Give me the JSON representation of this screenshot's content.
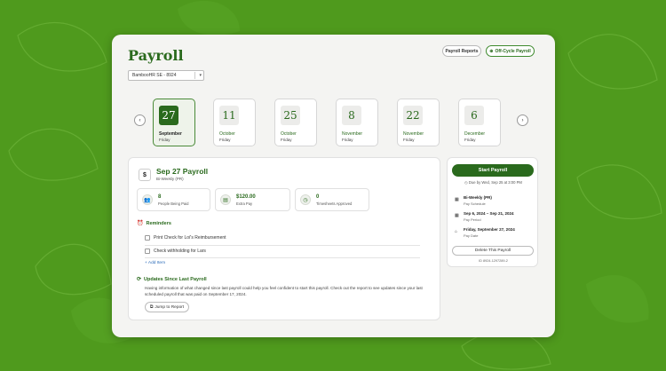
{
  "header": {
    "title": "Payroll",
    "reports_label": "Payroll Reports",
    "offcycle_label": "Off-Cycle Payroll"
  },
  "company_select": {
    "value": "BambooHR SE - 8924"
  },
  "dates": [
    {
      "num": "27",
      "month": "September",
      "day": "Friday",
      "active": true
    },
    {
      "num": "11",
      "month": "October",
      "day": "Friday",
      "active": false
    },
    {
      "num": "25",
      "month": "October",
      "day": "Friday",
      "active": false
    },
    {
      "num": "8",
      "month": "November",
      "day": "Friday",
      "active": false
    },
    {
      "num": "22",
      "month": "November",
      "day": "Friday",
      "active": false
    },
    {
      "num": "6",
      "month": "December",
      "day": "Friday",
      "active": false
    }
  ],
  "payroll": {
    "title": "Sep 27 Payroll",
    "subtitle": "Bi-Weekly (PR)",
    "stats": [
      {
        "value": "8",
        "label": "People Being Paid",
        "icon": "people-icon"
      },
      {
        "value": "$120.00",
        "label": "Extra Pay",
        "icon": "money-icon"
      },
      {
        "value": "0",
        "label": "Timesheets Approved",
        "icon": "clock-icon"
      }
    ]
  },
  "reminders": {
    "heading": "Reminders",
    "items": [
      "Print Check for Loï's Reimbursement",
      "Check withholding for Lars"
    ],
    "add_label": "+ Add Item"
  },
  "updates": {
    "heading": "Updates Since Last Payroll",
    "text": "Having information of what changed since last payroll could help you feel confident to start this payroll. Check out the report to see updates since your last scheduled payroll that was paid on September 17, 2024.",
    "jump_label": "Jump to Report"
  },
  "sidebar": {
    "start_label": "Start Payroll",
    "due": "Due by Wed, Sep 25 at 3:00 PM",
    "rows": [
      {
        "main": "Bi-Weekly (PR)",
        "sub": "Pay Schedule",
        "icon": "calendar-icon"
      },
      {
        "main": "Sep 6, 2024 – Sep 21, 2024",
        "sub": "Pay Period",
        "icon": "calendar-range-icon"
      },
      {
        "main": "Friday, September 27, 2024",
        "sub": "Pay Date",
        "icon": "bank-icon"
      }
    ],
    "delete_label": "Delete This Payroll",
    "id": "ID 8924-1297289-2"
  },
  "colors": {
    "brand": "#2a6a1d",
    "background": "#4f9a1d"
  }
}
